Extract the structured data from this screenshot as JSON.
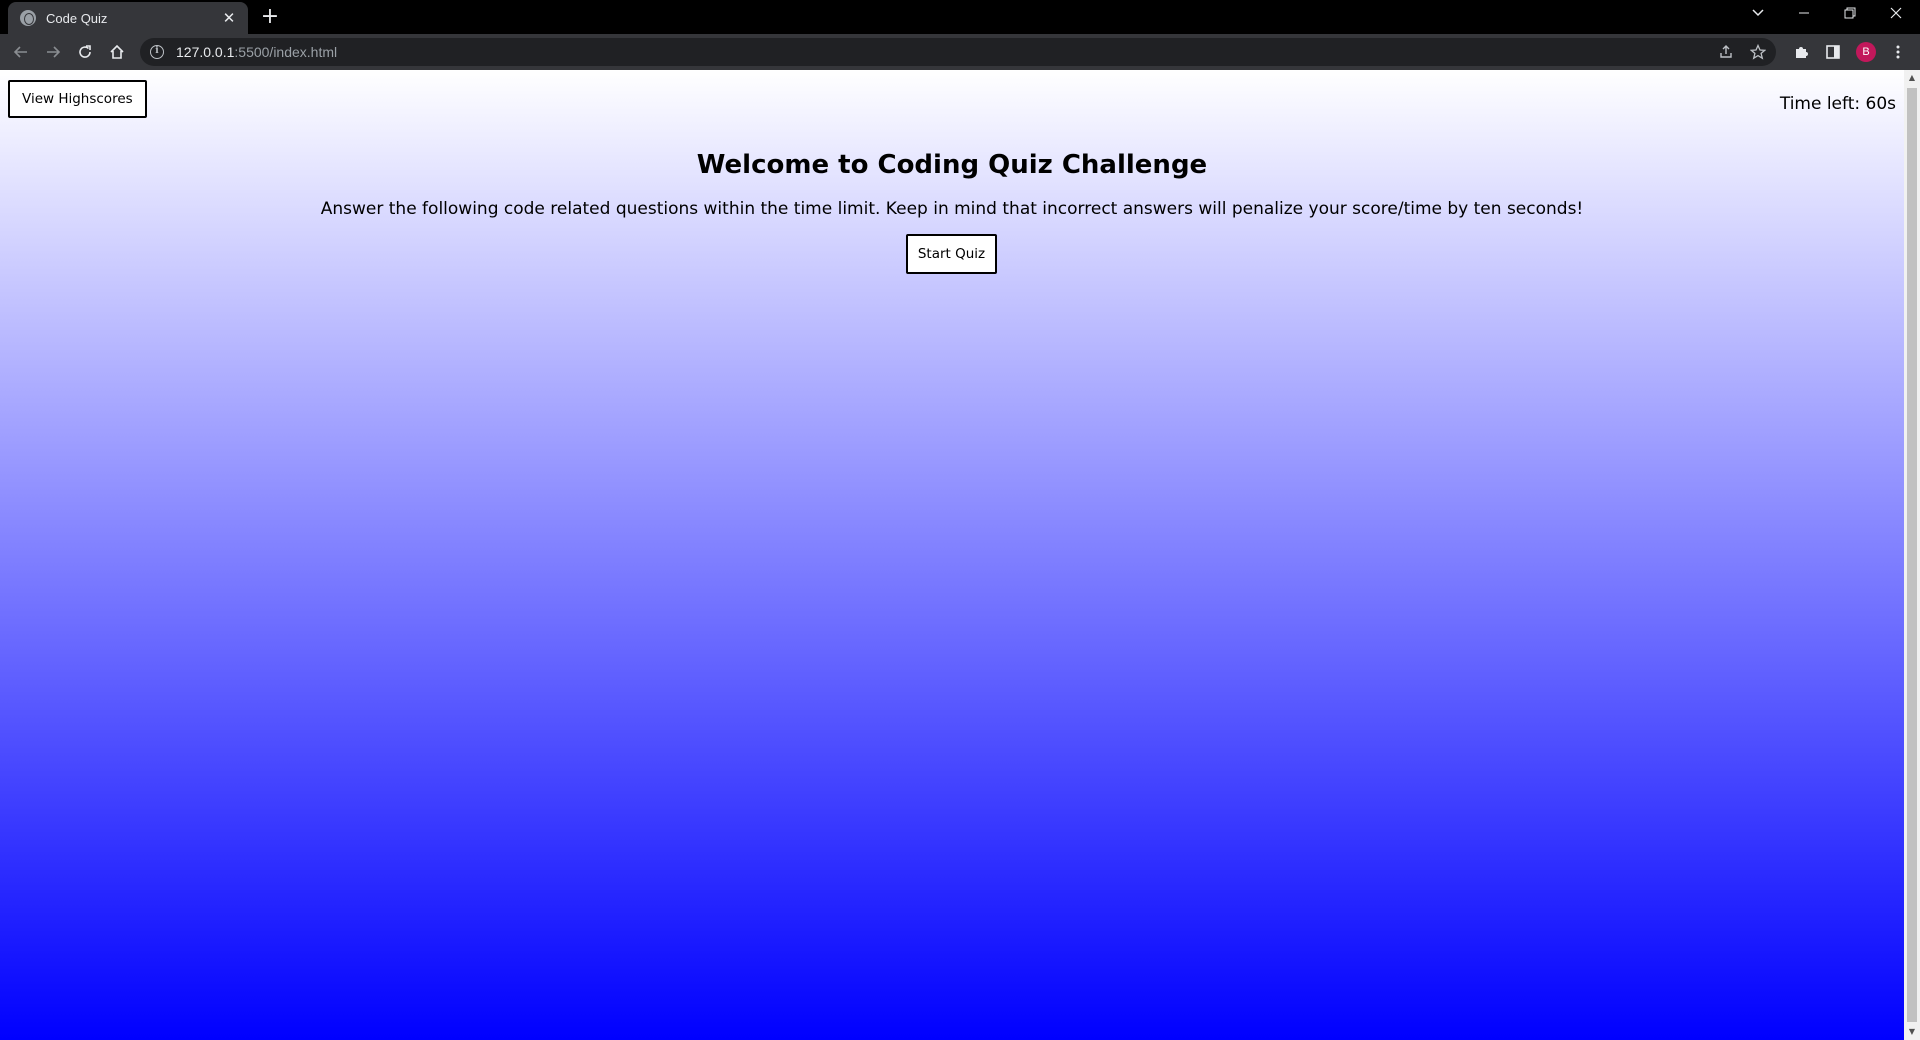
{
  "browser": {
    "tab": {
      "title": "Code Quiz",
      "favicon": "globe-icon"
    },
    "url": {
      "host": "127.0.0.1",
      "path": ":5500/index.html"
    },
    "profile_initial": "B",
    "colors": {
      "frame": "#000000",
      "toolbar": "#35363a",
      "omnibox": "#202124",
      "avatar": "#c2185b"
    }
  },
  "page": {
    "highscores_label": "View Highscores",
    "timer": "Time left: 60s",
    "title": "Welcome to Coding Quiz Challenge",
    "description": "Answer the following code related questions within the time limit. Keep in mind that incorrect answers will penalize your score/time by ten seconds!",
    "start_label": "Start Quiz",
    "background_gradient": [
      "#ffffff",
      "#0000ff"
    ]
  }
}
